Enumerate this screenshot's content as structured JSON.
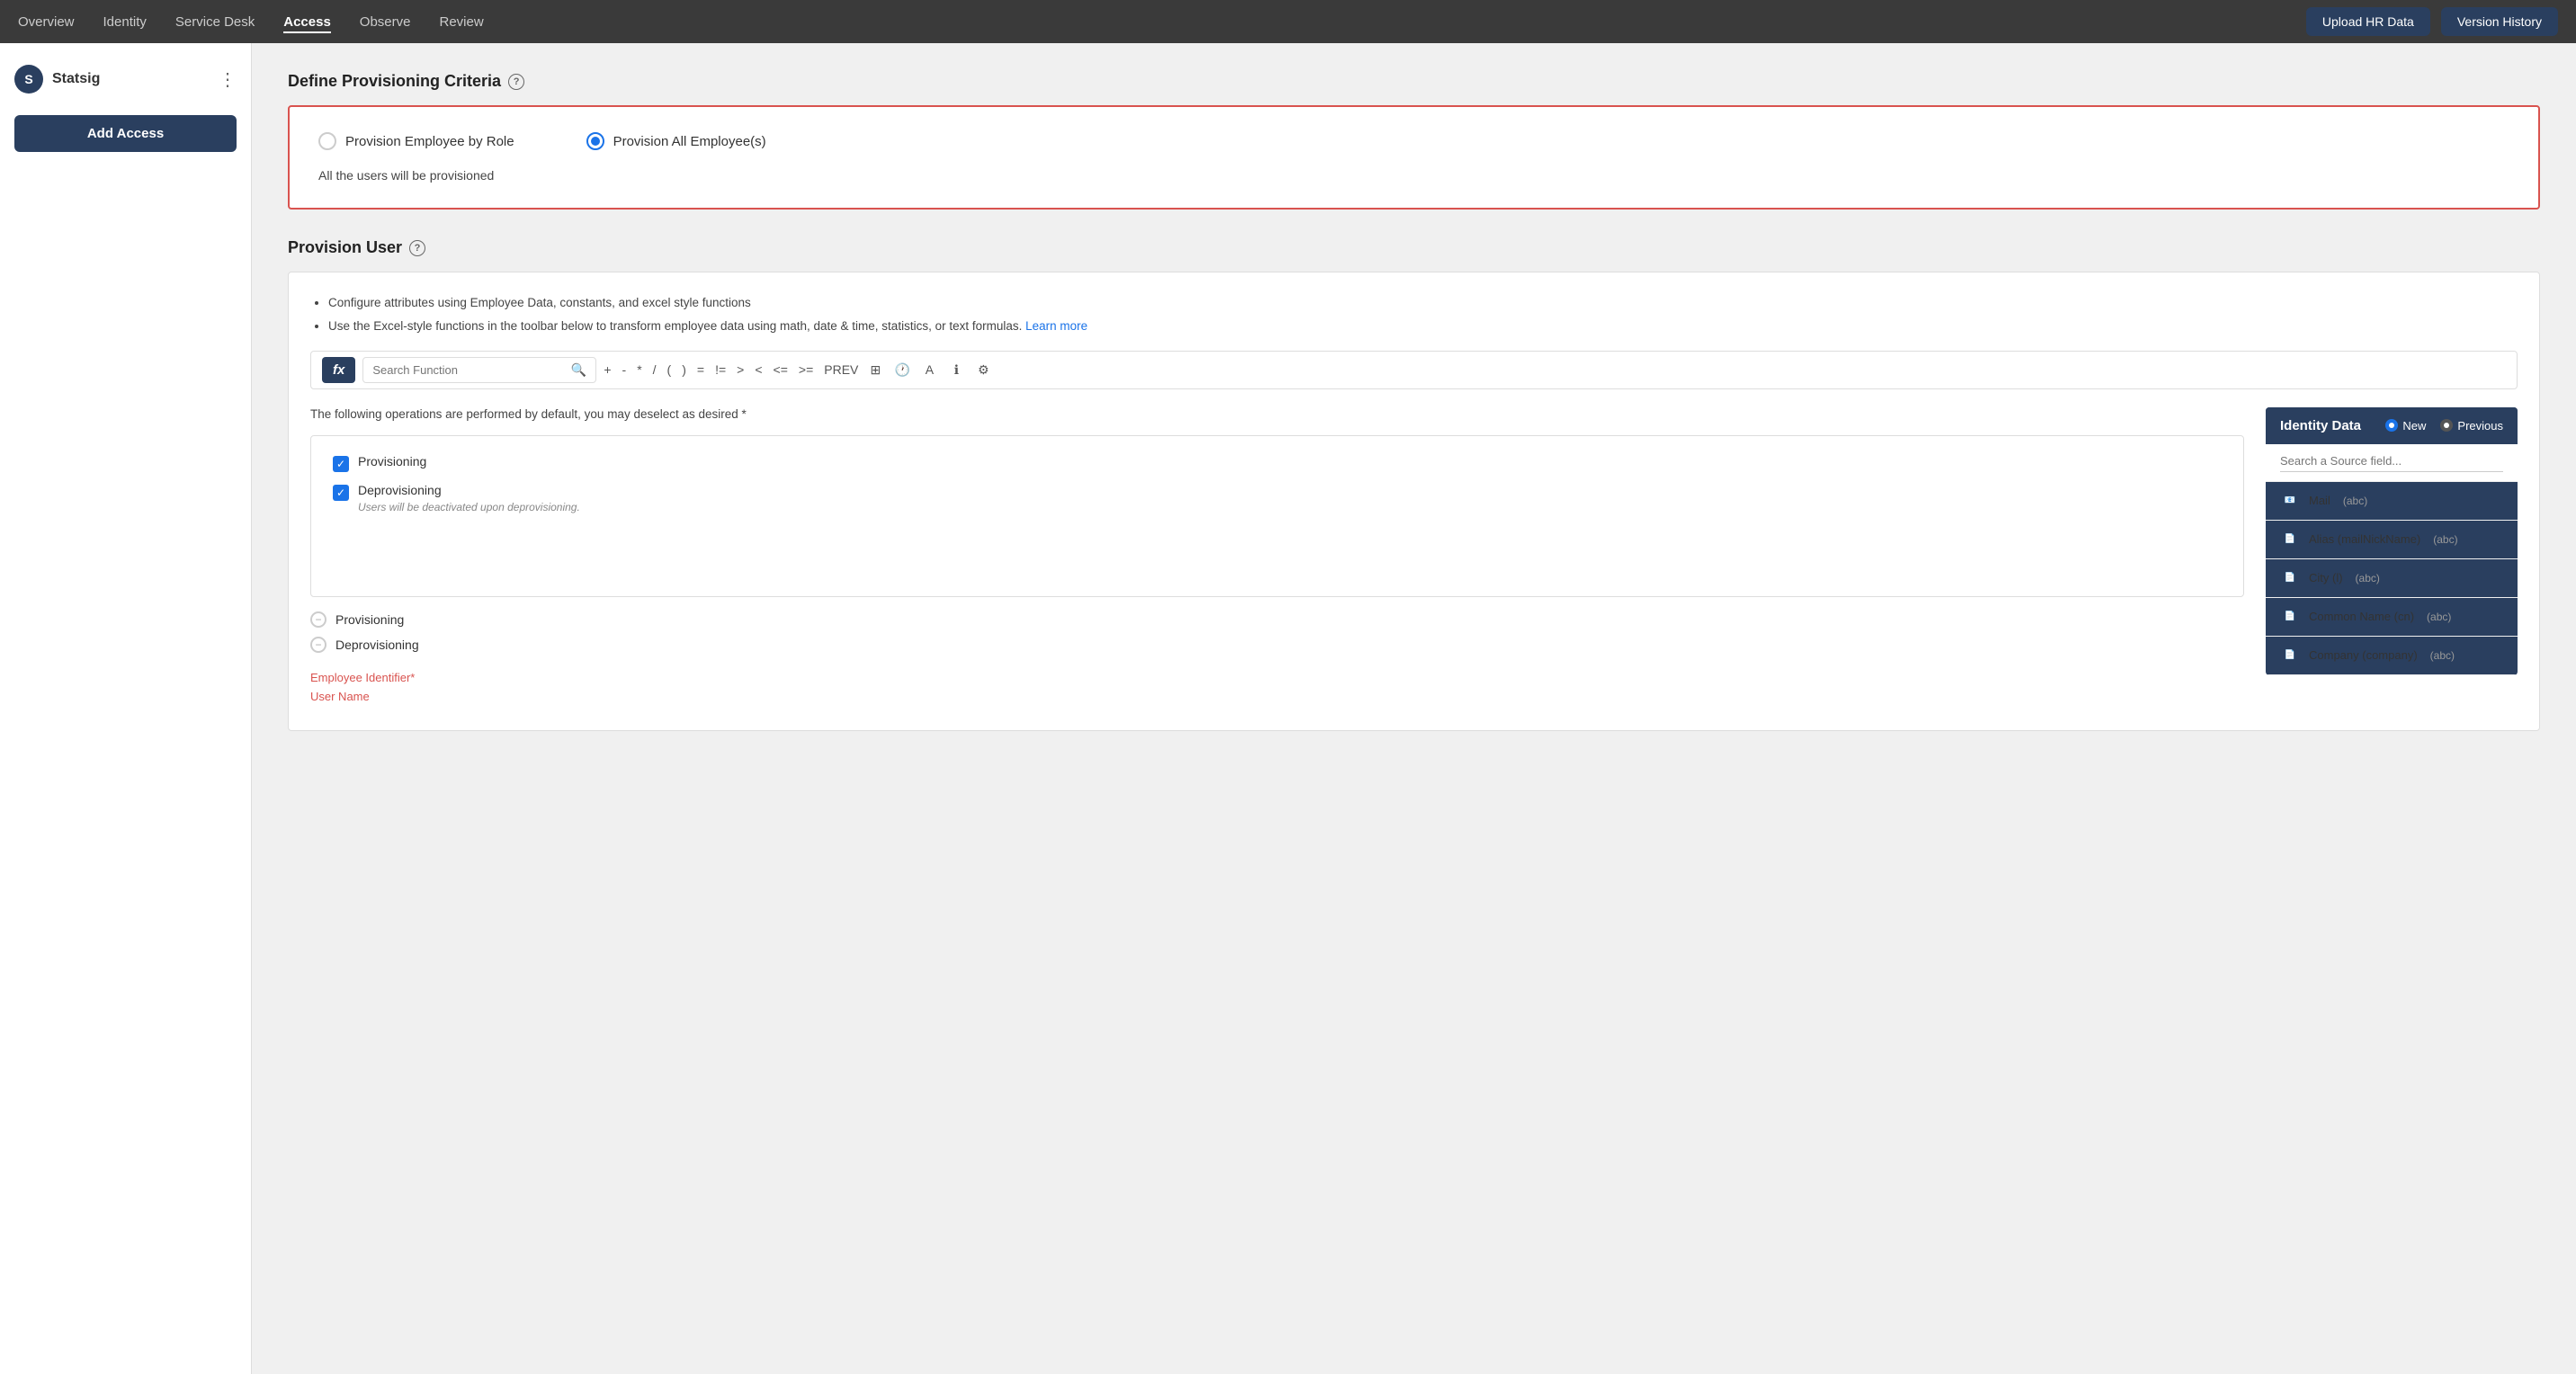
{
  "nav": {
    "items": [
      {
        "label": "Overview",
        "active": false
      },
      {
        "label": "Identity",
        "active": false
      },
      {
        "label": "Service Desk",
        "active": false
      },
      {
        "label": "Access",
        "active": true
      },
      {
        "label": "Observe",
        "active": false
      },
      {
        "label": "Review",
        "active": false
      }
    ],
    "upload_btn": "Upload HR Data",
    "version_btn": "Version History"
  },
  "sidebar": {
    "logo": "S",
    "app_name": "Statsig",
    "add_access_btn": "Add Access"
  },
  "criteria_section": {
    "title": "Define Provisioning Criteria",
    "help": "?",
    "option1": "Provision Employee by Role",
    "option2": "Provision All Employee(s)",
    "note": "All the users will be provisioned"
  },
  "provision_section": {
    "title": "Provision User",
    "help": "?",
    "bullet1": "Configure attributes using Employee Data, constants, and excel style functions",
    "bullet2": "Use the Excel-style functions in the toolbar below to transform employee data using math, date & time, statistics, or text formulas.",
    "learn_more": "Learn more",
    "fx_label": "fx",
    "search_placeholder": "Search Function",
    "toolbar_ops": [
      "+",
      "-",
      "*",
      "/",
      "(",
      ")",
      "=",
      "!=",
      ">",
      "<",
      "<=",
      ">=",
      "PREV"
    ],
    "ops_note": "The following operations are performed by default, you may deselect as desired *",
    "checkbox1_label": "Provisioning",
    "checkbox2_label": "Deprovisioning",
    "deprovisioning_note": "Users will be deactivated upon deprovisioning.",
    "circle1_label": "Provisioning",
    "circle2_label": "Deprovisioning",
    "employee_id_label": "Employee Identifier*",
    "user_name_label": "User Name"
  },
  "identity_panel": {
    "title": "Identity Data",
    "new_label": "New",
    "previous_label": "Previous",
    "search_placeholder": "Search a Source field...",
    "fields": [
      {
        "name": "Mail",
        "type": "(abc)"
      },
      {
        "name": "Alias (mailNickName)",
        "type": "(abc)"
      },
      {
        "name": "City (l)",
        "type": "(abc)"
      },
      {
        "name": "Common Name (cn)",
        "type": "(abc)"
      },
      {
        "name": "Company (company)",
        "type": "(abc)"
      }
    ]
  }
}
